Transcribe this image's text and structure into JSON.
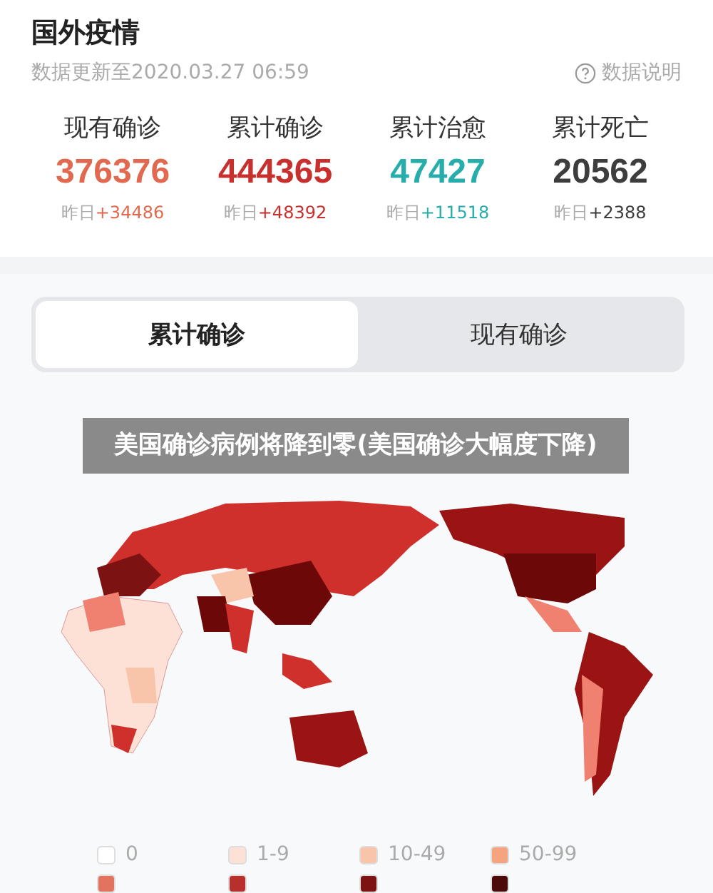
{
  "header": {
    "title": "国外疫情",
    "updated": "数据更新至2020.03.27 06:59",
    "help_link": "数据说明"
  },
  "stats": [
    {
      "label": "现有确诊",
      "value": "376376",
      "delta_label": "昨日",
      "delta": "+34486",
      "color": "#e0694f"
    },
    {
      "label": "累计确诊",
      "value": "444365",
      "delta_label": "昨日",
      "delta": "+48392",
      "color": "#c8302e"
    },
    {
      "label": "累计治愈",
      "value": "47427",
      "delta_label": "昨日",
      "delta": "+11518",
      "color": "#27aeac"
    },
    {
      "label": "累计死亡",
      "value": "20562",
      "delta_label": "昨日",
      "delta": "+2388",
      "color": "#3d3d3d"
    }
  ],
  "tabs": [
    {
      "label": "累计确诊",
      "selected": true
    },
    {
      "label": "现有确诊",
      "selected": false
    }
  ],
  "banner": {
    "text": "美国确诊病例将降到零(美国确诊大幅度下降)"
  },
  "legend": [
    {
      "label": "0",
      "color": "#ffffff"
    },
    {
      "label": "1-9",
      "color": "#fde0d6"
    },
    {
      "label": "10-49",
      "color": "#f8c4aa"
    },
    {
      "label": "50-99",
      "color": "#f5a47f"
    },
    {
      "color": "#e2735f"
    },
    {
      "color": "#b8302c"
    },
    {
      "color": "#7d1212"
    },
    {
      "color": "#4d0a0a"
    }
  ]
}
